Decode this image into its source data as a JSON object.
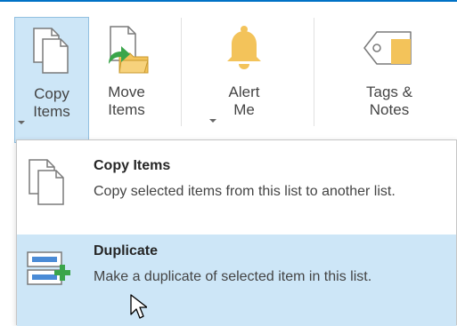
{
  "ribbon": {
    "copy_items": {
      "line1": "Copy",
      "line2": "Items"
    },
    "move_items": {
      "line1": "Move",
      "line2": "Items"
    },
    "alert_me": {
      "line1": "Alert",
      "line2": "Me"
    },
    "tags_notes": {
      "line1": "Tags &",
      "line2": "Notes"
    }
  },
  "menu": {
    "items": [
      {
        "title": "Copy Items",
        "description": "Copy selected items from this list to another list.",
        "icon": "copy-pages-icon"
      },
      {
        "title": "Duplicate",
        "description": "Make a duplicate of selected item in this list.",
        "icon": "duplicate-icon",
        "highlighted": true
      }
    ]
  },
  "colors": {
    "accent": "#0072c6",
    "hover": "#cde6f7",
    "alert_bell": "#f3c35a",
    "folder": "#f3c35a",
    "green": "#3aa54a"
  }
}
